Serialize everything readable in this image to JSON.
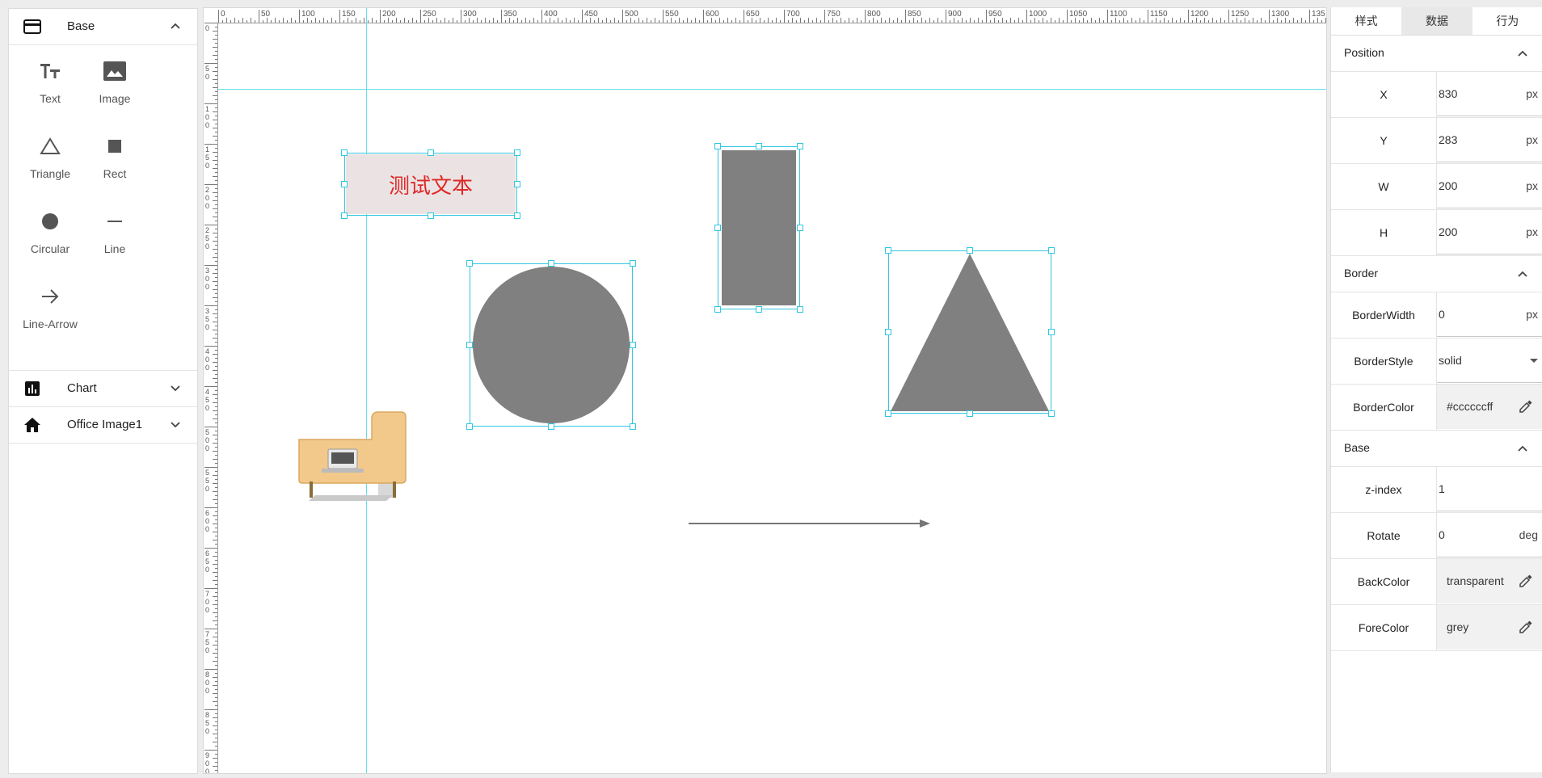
{
  "left_panel": {
    "sections": [
      {
        "label": "Base",
        "icon": "card-icon",
        "expanded": true
      },
      {
        "label": "Chart",
        "icon": "bar-chart-icon",
        "expanded": false
      },
      {
        "label": "Office Image1",
        "icon": "home-icon",
        "expanded": false
      }
    ],
    "tools": [
      {
        "label": "Text",
        "icon": "text-icon"
      },
      {
        "label": "Image",
        "icon": "image-icon"
      },
      {
        "label": "Triangle",
        "icon": "triangle-icon"
      },
      {
        "label": "Rect",
        "icon": "rect-icon"
      },
      {
        "label": "Circular",
        "icon": "circle-icon"
      },
      {
        "label": "Line",
        "icon": "line-icon"
      },
      {
        "label": "Line-Arrow",
        "icon": "arrow-icon"
      }
    ]
  },
  "canvas": {
    "ruler_ticks": [
      "0",
      "50",
      "100",
      "150",
      "200",
      "250",
      "300",
      "350",
      "400",
      "450",
      "500",
      "550",
      "600",
      "650",
      "700",
      "750",
      "800",
      "850",
      "900",
      "950",
      "1000",
      "1050",
      "1100",
      "1150",
      "1200",
      "1250",
      "1300",
      "135"
    ],
    "ruler_left_ticks": [
      "0",
      "50",
      "100",
      "150",
      "200",
      "250",
      "300",
      "350",
      "400",
      "450",
      "500",
      "550",
      "600",
      "650",
      "700",
      "750",
      "800",
      "850",
      "900"
    ],
    "text_element": "测试文本",
    "colors": {
      "guide": "#66e0e6",
      "selection": "#31c7e0",
      "shape_fill": "#808080",
      "text_color": "#e02828",
      "text_bg": "#ebe3e3"
    }
  },
  "right_panel": {
    "tabs": [
      {
        "label": "样式",
        "active": false
      },
      {
        "label": "数据",
        "active": true
      },
      {
        "label": "行为",
        "active": false
      }
    ],
    "position": {
      "title": "Position",
      "rows": [
        {
          "label": "X",
          "value": "830",
          "unit": "px"
        },
        {
          "label": "Y",
          "value": "283",
          "unit": "px"
        },
        {
          "label": "W",
          "value": "200",
          "unit": "px"
        },
        {
          "label": "H",
          "value": "200",
          "unit": "px"
        }
      ]
    },
    "border": {
      "title": "Border",
      "width_label": "BorderWidth",
      "width_value": "0",
      "width_unit": "px",
      "style_label": "BorderStyle",
      "style_value": "solid",
      "color_label": "BorderColor",
      "color_value": "#ccccccff"
    },
    "base": {
      "title": "Base",
      "zindex_label": "z-index",
      "zindex_value": "1",
      "rotate_label": "Rotate",
      "rotate_value": "0",
      "rotate_unit": "deg",
      "backcolor_label": "BackColor",
      "backcolor_value": "transparent",
      "forecolor_label": "ForeColor",
      "forecolor_value": "grey"
    }
  }
}
